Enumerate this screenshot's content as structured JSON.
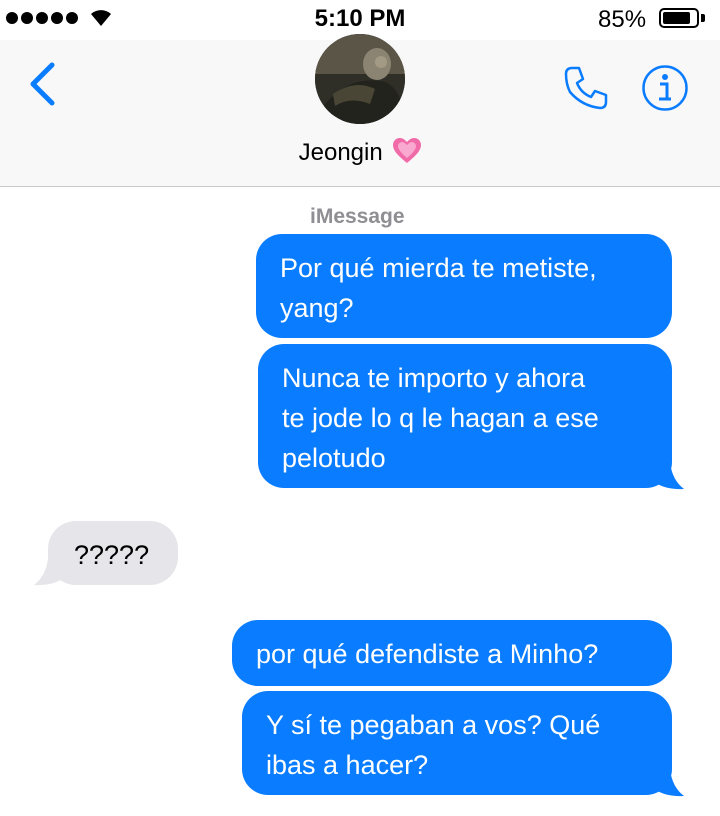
{
  "status_bar": {
    "time": "5:10 PM",
    "battery_percent": "85%",
    "battery_level": 0.85,
    "signal_bars": 5
  },
  "header": {
    "contact_name": "Jeongin",
    "contact_emoji": "growing-heart-icon"
  },
  "conversation": {
    "service_label": "iMessage",
    "messages": [
      {
        "direction": "outgoing",
        "lines": [
          "Por qué mierda te metiste,",
          "yang?"
        ]
      },
      {
        "direction": "outgoing",
        "lines": [
          "Nunca te importo y ahora",
          "te jode lo q le hagan a ese",
          "pelotudo"
        ]
      },
      {
        "direction": "incoming",
        "lines": [
          "?????"
        ]
      },
      {
        "direction": "outgoing",
        "lines": [
          "por qué defendiste a Minho?"
        ]
      },
      {
        "direction": "outgoing",
        "lines": [
          "Y sí te pegaban a vos? Qué",
          "ibas a hacer?"
        ]
      }
    ]
  },
  "colors": {
    "accent": "#0a7cff",
    "incoming_bubble": "#e5e5ea",
    "header_bg": "#f8f8f8",
    "service_label": "#8e8e93"
  }
}
